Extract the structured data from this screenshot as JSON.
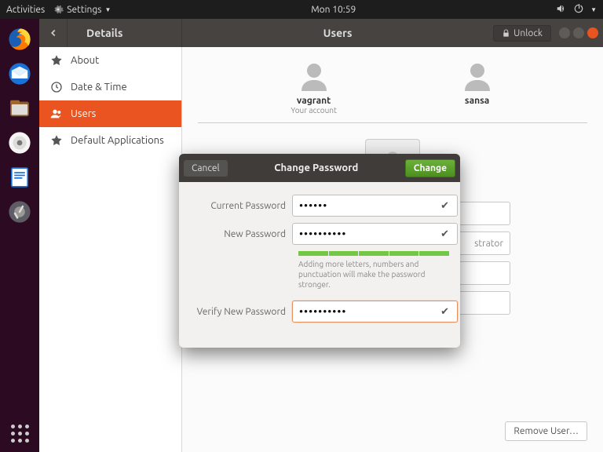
{
  "topbar": {
    "activities": "Activities",
    "app": "Settings",
    "clock": "Mon 10:59"
  },
  "window": {
    "title_left": "Details",
    "title_center": "Users",
    "unlock": "Unlock"
  },
  "sidebar": {
    "items": [
      {
        "label": "About"
      },
      {
        "label": "Date & Time"
      },
      {
        "label": "Users"
      },
      {
        "label": "Default Applications"
      }
    ]
  },
  "users": [
    {
      "name": "vagrant",
      "sub": "Your account"
    },
    {
      "name": "sansa",
      "sub": ""
    }
  ],
  "form": {
    "admin_text": "strator",
    "remove": "Remove User…"
  },
  "dialog": {
    "cancel": "Cancel",
    "title": "Change Password",
    "change": "Change",
    "current_label": "Current Password",
    "current_value": "••••••",
    "new_label": "New Password",
    "new_value": "••••••••••",
    "hint": "Adding more letters, numbers and punctuation will make the password stronger.",
    "verify_label": "Verify New Password",
    "verify_value": "••••••••••"
  }
}
